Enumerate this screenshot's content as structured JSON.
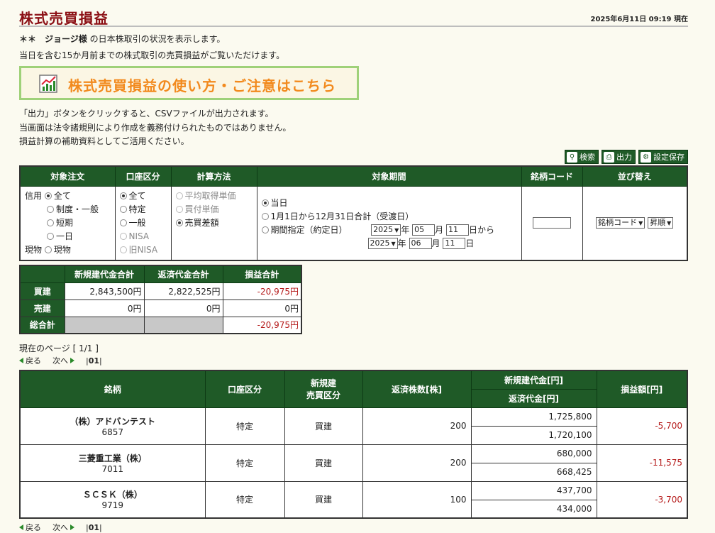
{
  "header": {
    "title": "株式売買損益",
    "timestamp": "2025年6月11日 09:19 現在"
  },
  "intro": {
    "user_prefix": "＊＊　ジョージ様",
    "user_suffix": " の日本株取引の状況を表示します。",
    "line2": "当日を含む15か月前までの株式取引の売買損益がご覧いただけます。"
  },
  "banner": {
    "text": "株式売買損益の使い方・ご注意はこちら",
    "icon": "chart-icon"
  },
  "notes": [
    "「出力」ボタンをクリックすると、CSVファイルが出力されます。",
    "当画面は法令諸規則により作成を義務付けられたものではありません。",
    "損益計算の補助資料としてご活用ください。"
  ],
  "buttons": {
    "search": "検索",
    "output": "出力",
    "save": "設定保存"
  },
  "filters": {
    "headers": [
      "対象注文",
      "口座区分",
      "計算方法",
      "対象期間",
      "銘柄コード",
      "並び替え"
    ],
    "order": {
      "shinyo_label": "信用",
      "genbutsu_label": "現物",
      "options": [
        "全て",
        "制度・一般",
        "短期",
        "一日",
        "現物"
      ]
    },
    "account": {
      "options": [
        "全て",
        "特定",
        "一般",
        "NISA",
        "旧NISA"
      ]
    },
    "calc": {
      "options": [
        "平均取得単価",
        "買付単価",
        "売買差額"
      ]
    },
    "period": {
      "options": [
        "当日",
        "1月1日から12月31日合計（受渡日）",
        "期間指定（約定日）"
      ],
      "from": {
        "year": "2025",
        "month": "05",
        "day": "11",
        "suffix": "日から"
      },
      "to": {
        "year": "2025",
        "month": "06",
        "day": "11",
        "suffix": "日"
      },
      "year_label": "年",
      "month_label": "月"
    },
    "code": {
      "value": ""
    },
    "sort": {
      "key": "銘柄コード",
      "order": "昇順"
    }
  },
  "summary": {
    "headers": [
      "新規建代金合計",
      "返済代金合計",
      "損益合計"
    ],
    "rows": [
      {
        "label": "買建",
        "new": "2,843,500円",
        "repay": "2,822,525円",
        "pnl": "-20,975円"
      },
      {
        "label": "売建",
        "new": "0円",
        "repay": "0円",
        "pnl": "0円"
      },
      {
        "label": "総合計",
        "pnl": "-20,975円"
      }
    ]
  },
  "pager": {
    "current": "現在のページ [ 1/1 ]",
    "prev": "戻る",
    "next": "次へ",
    "page": "01"
  },
  "results": {
    "headers": {
      "name": "銘柄",
      "account": "口座区分",
      "trade_line1": "新規建",
      "trade_line2": "売買区分",
      "qty": "返済株数[株]",
      "new_amt": "新規建代金[円]",
      "repay_amt": "返済代金[円]",
      "pnl": "損益額[円]"
    },
    "rows": [
      {
        "name": "（株）アドバンテスト",
        "code": "6857",
        "account": "特定",
        "trade": "買建",
        "qty": "200",
        "new_amt": "1,725,800",
        "repay_amt": "1,720,100",
        "pnl": "-5,700"
      },
      {
        "name": "三菱重工業（株）",
        "code": "7011",
        "account": "特定",
        "trade": "買建",
        "qty": "200",
        "new_amt": "680,000",
        "repay_amt": "668,425",
        "pnl": "-11,575"
      },
      {
        "name": "ＳＣＳＫ（株）",
        "code": "9719",
        "account": "特定",
        "trade": "買建",
        "qty": "100",
        "new_amt": "437,700",
        "repay_amt": "434,000",
        "pnl": "-3,700"
      }
    ]
  }
}
